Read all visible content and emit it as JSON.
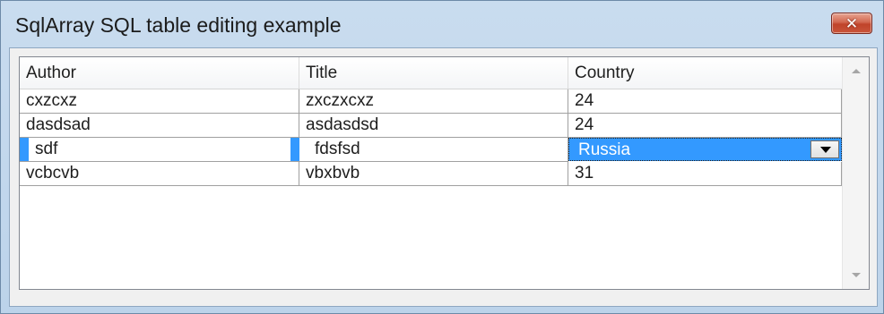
{
  "window": {
    "title": "SqlArray SQL table editing example",
    "close_glyph": "✕"
  },
  "table": {
    "columns": [
      "Author",
      "Title",
      "Country"
    ],
    "rows": [
      {
        "author": "cxzcxz",
        "title": "zxczxcxz",
        "country": "24"
      },
      {
        "author": "dasdsad",
        "title": "asdasdsd",
        "country": "24"
      },
      {
        "author": "sdf",
        "title": "fdsfsd",
        "country": "Russia"
      },
      {
        "author": "vcbcvb",
        "title": "vbxbvb",
        "country": "31"
      }
    ],
    "selected_row_index": 2
  },
  "colors": {
    "selection": "#3399ff",
    "close_button": "#c9553b",
    "frame": "#bcd3ea"
  },
  "icons": {
    "close": "close-icon",
    "dropdown": "chevron-down-icon",
    "scroll_up": "scroll-up-icon",
    "scroll_down": "scroll-down-icon"
  }
}
